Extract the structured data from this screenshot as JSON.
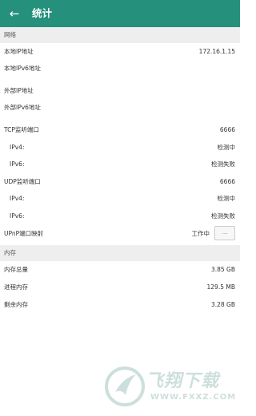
{
  "appbar": {
    "back_icon": "arrow-left-icon",
    "title": "统计",
    "color": "#25907c"
  },
  "sections": {
    "network": {
      "header": "网络",
      "local_ipv4": {
        "label": "本地IP地址",
        "value": "172.16.1.15"
      },
      "local_ipv6": {
        "label": "本地IPv6地址",
        "value": ""
      },
      "external_ipv4": {
        "label": "外部IP地址",
        "value": ""
      },
      "external_ipv6": {
        "label": "外部IPv6地址",
        "value": ""
      },
      "tcp_port": {
        "label": "TCP监听端口",
        "value": "6666"
      },
      "tcp_ipv4": {
        "label": "IPv4:",
        "value": "检测中"
      },
      "tcp_ipv6": {
        "label": "IPv6:",
        "value": "检测失败"
      },
      "udp_port": {
        "label": "UDP监听端口",
        "value": "6666"
      },
      "udp_ipv4": {
        "label": "IPv4:",
        "value": "检测中"
      },
      "udp_ipv6": {
        "label": "IPv6:",
        "value": "检测失败"
      },
      "upnp": {
        "label": "UPnP端口映射",
        "value": "工作中",
        "button_label": "..."
      }
    },
    "memory": {
      "header": "内存",
      "total": {
        "label": "内存总量",
        "value": "3.85 GB"
      },
      "process": {
        "label": "进程内存",
        "value": "129.5 MB"
      },
      "free": {
        "label": "剩余内存",
        "value": "3.28 GB"
      }
    }
  },
  "watermark": {
    "text": "飞翔下载",
    "url": "WWW.FXXZ.COM"
  }
}
